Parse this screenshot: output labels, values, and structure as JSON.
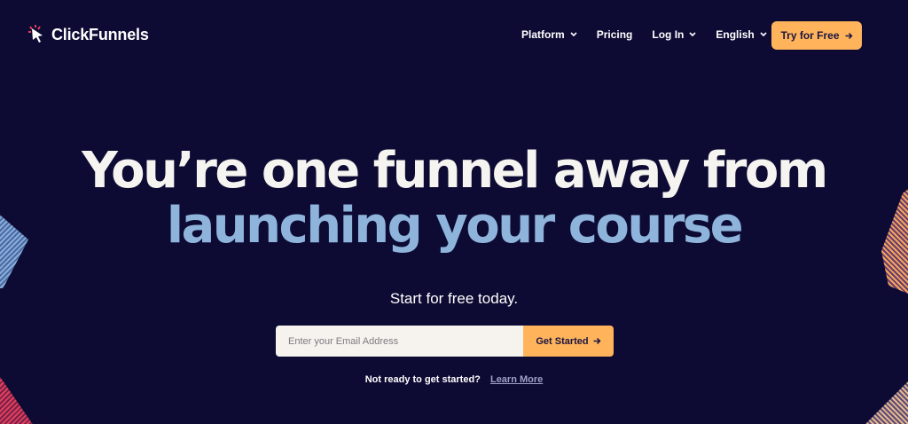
{
  "brand": {
    "name": "ClickFunnels",
    "accent_orange": "#ffb45c",
    "hero_blue": "#8fb4dc",
    "background": "#0d0b33"
  },
  "nav": {
    "items": [
      {
        "label": "Platform",
        "has_dropdown": true
      },
      {
        "label": "Pricing",
        "has_dropdown": false
      },
      {
        "label": "Log In",
        "has_dropdown": true
      },
      {
        "label": "English",
        "has_dropdown": true
      }
    ],
    "cta_label": "Try for Free"
  },
  "hero": {
    "line1": "You’re one funnel away from",
    "line2": "launching your course",
    "subtitle": "Start for free today."
  },
  "signup": {
    "email_placeholder": "Enter your Email Address",
    "button_label": "Get Started"
  },
  "footer_prompt": {
    "text": "Not ready to get started?",
    "link_label": "Learn More"
  }
}
